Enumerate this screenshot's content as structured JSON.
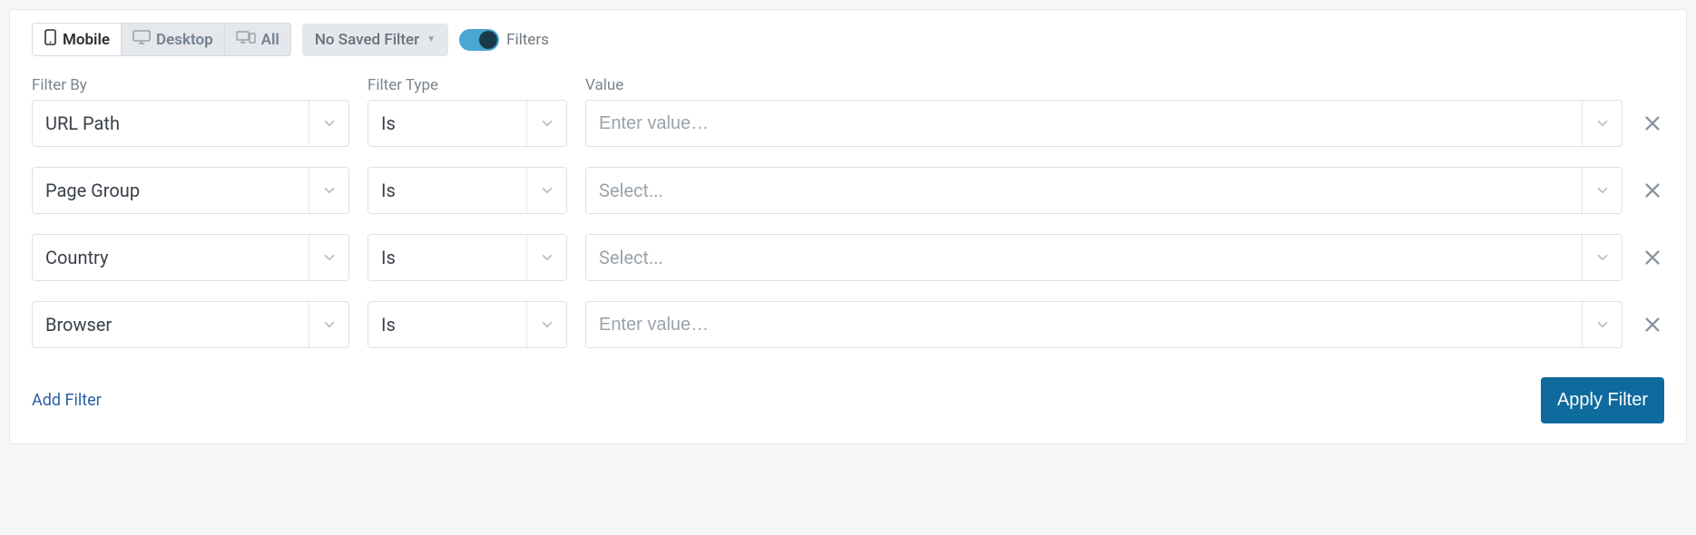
{
  "topbar": {
    "device_tabs": {
      "mobile": "Mobile",
      "desktop": "Desktop",
      "all": "All"
    },
    "saved_filter_label": "No Saved Filter",
    "filters_toggle_label": "Filters"
  },
  "headers": {
    "filter_by": "Filter By",
    "filter_type": "Filter Type",
    "value": "Value"
  },
  "rows": [
    {
      "filter_by": "URL Path",
      "filter_type": "Is",
      "value_mode": "input",
      "value_placeholder": "Enter value…"
    },
    {
      "filter_by": "Page Group",
      "filter_type": "Is",
      "value_mode": "select",
      "value_placeholder": "Select..."
    },
    {
      "filter_by": "Country",
      "filter_type": "Is",
      "value_mode": "select",
      "value_placeholder": "Select..."
    },
    {
      "filter_by": "Browser",
      "filter_type": "Is",
      "value_mode": "input",
      "value_placeholder": "Enter value…"
    }
  ],
  "footer": {
    "add_filter": "Add Filter",
    "apply_filter": "Apply Filter"
  }
}
